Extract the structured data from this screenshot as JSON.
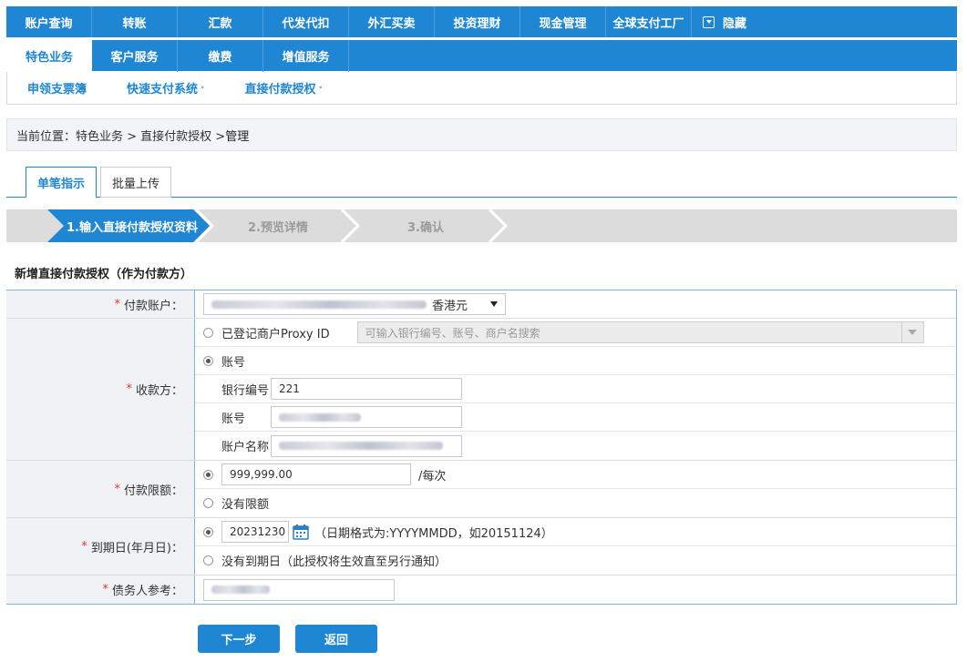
{
  "nav": {
    "row1": [
      "账户查询",
      "转账",
      "汇款",
      "代发代扣",
      "外汇买卖",
      "投资理财",
      "现金管理",
      "全球支付工厂"
    ],
    "hide_label": "隐藏",
    "row2": [
      "特色业务",
      "客户服务",
      "缴费",
      "增值服务"
    ]
  },
  "subnav": {
    "item1": "申领支票簿",
    "item2": "快速支付系统",
    "item3": "直接付款授权",
    "caret": "˅"
  },
  "breadcrumb": {
    "prefix": "当前位置：特色业务 > 直接付款授权 > ",
    "current": "管理"
  },
  "tabs": {
    "single": "单笔指示",
    "batch": "批量上传"
  },
  "steps": {
    "step1": "1.输入直接付款授权资料",
    "step2": "2.预览详情",
    "step3": "3.确认"
  },
  "section_title": "新增直接付款授权（作为付款方）",
  "form": {
    "required_mark": "*",
    "payer_account_label": "付款账户：",
    "payer_currency": "香港元",
    "payee_label": "收款方：",
    "proxy_label": "已登记商户Proxy ID",
    "proxy_placeholder": "可输入银行编号、账号、商户名搜索",
    "account_option": "账号",
    "bank_code_label": "银行编号",
    "bank_code_value": "221",
    "account_no_label": "账号",
    "account_name_label": "账户名称",
    "limit_label": "付款限额：",
    "limit_value": "999,999.00",
    "limit_unit": "/每次",
    "no_limit_option": "没有限额",
    "expiry_label": "到期日(年月日)：",
    "expiry_value": "20231230",
    "expiry_hint": "（日期格式为:YYYYMMDD，如20151124）",
    "no_expiry_option": "没有到期日（此授权将生效直至另行通知）",
    "debtor_ref_label": "债务人参考："
  },
  "buttons": {
    "next": "下一步",
    "back": "返回"
  },
  "colors": {
    "primary": "#1e86d3",
    "required": "#e23b2e",
    "label_bg": "#f0f2f5"
  }
}
